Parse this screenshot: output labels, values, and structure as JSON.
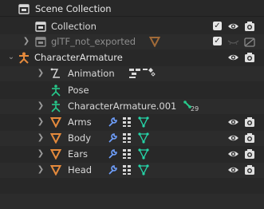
{
  "outliner": {
    "scene_title": "Scene Collection",
    "rows": [
      {
        "label": "Collection",
        "checked": true
      },
      {
        "label": "glTF_not_exported",
        "checked": true
      },
      {
        "label": "CharacterArmature"
      },
      {
        "label": "Animation"
      },
      {
        "label": "Pose"
      },
      {
        "label": "CharacterArmature.001",
        "bone_count": "29"
      },
      {
        "label": "Arms"
      },
      {
        "label": "Body"
      },
      {
        "label": "Ears"
      },
      {
        "label": "Head"
      }
    ]
  },
  "colors": {
    "background": "#282828",
    "row_alt": "#2c2c2c",
    "armature_green": "#27c98b",
    "mesh_orange": "#e58a3c",
    "modifier_blue": "#6fa0ff",
    "vertex_group_green": "#25d4a8"
  },
  "icons": {
    "scene": "scene-collection-icon",
    "collection": "collection-box-icon",
    "eye": "eye-icon",
    "camera": "camera-icon",
    "armature": "armature-icon",
    "mesh": "mesh-triangle-icon",
    "wrench": "wrench-icon",
    "vertex_groups": "vertex-groups-icon"
  }
}
